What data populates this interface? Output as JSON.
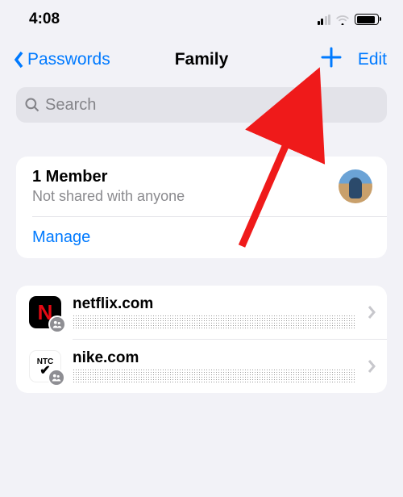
{
  "statusbar": {
    "time": "4:08"
  },
  "nav": {
    "back_label": "Passwords",
    "title": "Family",
    "edit_label": "Edit"
  },
  "search": {
    "placeholder": "Search"
  },
  "members_card": {
    "count_label": "1 Member",
    "subtitle": "Not shared with anyone",
    "manage_label": "Manage"
  },
  "passwords": [
    {
      "domain": "netflix.com",
      "icon": "netflix"
    },
    {
      "domain": "nike.com",
      "icon": "nike"
    }
  ]
}
